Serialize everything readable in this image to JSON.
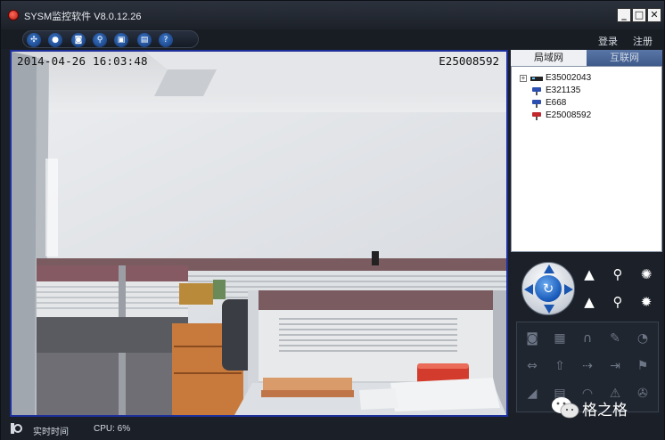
{
  "window": {
    "title": "SYSM监控软件  V8.0.12.26",
    "controls": {
      "minimize": "_",
      "maximize": "□",
      "close": "✕"
    }
  },
  "toolbar": {
    "buttons": [
      {
        "name": "layout",
        "icon": "grid-icon",
        "glyph": "✣"
      },
      {
        "name": "record",
        "icon": "record-icon",
        "glyph": "●"
      },
      {
        "name": "snapshot",
        "icon": "camera-icon",
        "glyph": "◙"
      },
      {
        "name": "search",
        "icon": "search-icon",
        "glyph": "⚲"
      },
      {
        "name": "lock",
        "icon": "lock-icon",
        "glyph": "▣"
      },
      {
        "name": "storage",
        "icon": "storage-icon",
        "glyph": "▤"
      },
      {
        "name": "help",
        "icon": "help-icon",
        "glyph": "?"
      }
    ],
    "login": "登录",
    "register": "注册"
  },
  "video": {
    "timestamp": "2014-04-26 16:03:48",
    "device_id": "E25008592"
  },
  "device_panel": {
    "tabs": [
      {
        "label": "局域网",
        "active": true
      },
      {
        "label": "互联网",
        "active": false
      }
    ],
    "devices": [
      {
        "label": "E35002043",
        "type": "nvr",
        "expand": "+"
      },
      {
        "label": "E321135",
        "type": "camera-blue"
      },
      {
        "label": "E668",
        "type": "camera-blue"
      },
      {
        "label": "E25008592",
        "type": "camera-red"
      }
    ]
  },
  "ptz": {
    "center_icon": "refresh-icon",
    "center_glyph": "↻",
    "side_buttons": [
      {
        "name": "zoom-in",
        "icon": "triangle-up-icon",
        "glyph": "▲"
      },
      {
        "name": "focus-in",
        "icon": "magnifier-icon",
        "glyph": "⚲"
      },
      {
        "name": "iris-open",
        "icon": "sun-icon",
        "glyph": "✺"
      },
      {
        "name": "zoom-out",
        "icon": "triangle-up-icon",
        "glyph": "▲"
      },
      {
        "name": "focus-out",
        "icon": "magnifier-icon",
        "glyph": "⚲"
      },
      {
        "name": "iris-close",
        "icon": "gear-outline-icon",
        "glyph": "✹"
      }
    ]
  },
  "functions": [
    {
      "name": "capture",
      "icon": "camera-icon",
      "glyph": "◙"
    },
    {
      "name": "record",
      "icon": "clapper-icon",
      "glyph": "▦"
    },
    {
      "name": "audio",
      "icon": "headphones-icon",
      "glyph": "∩"
    },
    {
      "name": "talk",
      "icon": "microphone-icon",
      "glyph": "✎"
    },
    {
      "name": "cruise",
      "icon": "globe-icon",
      "glyph": "◔"
    },
    {
      "name": "flip-horizontal",
      "icon": "double-arrow-icon",
      "glyph": "⇔"
    },
    {
      "name": "flip-vertical",
      "icon": "arrow-up-icon",
      "glyph": "⇧"
    },
    {
      "name": "forward",
      "icon": "arrow-right-icon",
      "glyph": "⇢"
    },
    {
      "name": "enter",
      "icon": "enter-icon",
      "glyph": "⇥"
    },
    {
      "name": "flag",
      "icon": "flag-icon",
      "glyph": "⚑"
    },
    {
      "name": "speed",
      "icon": "ramp-icon",
      "glyph": "◢"
    },
    {
      "name": "channel",
      "icon": "grid-small-icon",
      "glyph": "▤"
    },
    {
      "name": "wifi",
      "icon": "wifi-icon",
      "glyph": "◠"
    },
    {
      "name": "alarm",
      "icon": "warning-icon",
      "glyph": "⚠"
    },
    {
      "name": "settings",
      "icon": "wrench-icon",
      "glyph": "✇"
    }
  ],
  "status": {
    "label": "实时时间",
    "cpu": "CPU:  6%"
  },
  "watermark": {
    "text": "格之格",
    "icon": "wechat-icon"
  }
}
